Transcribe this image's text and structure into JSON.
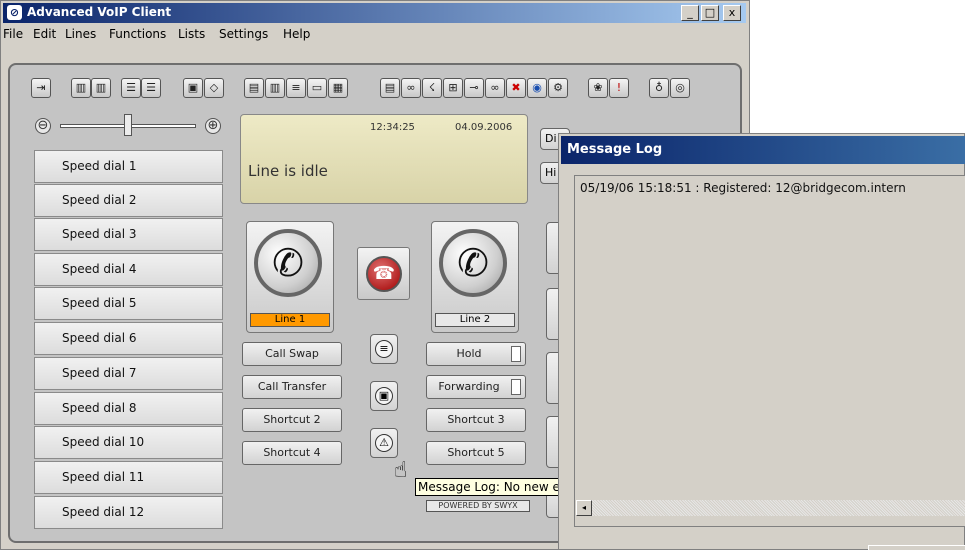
{
  "window": {
    "title": "Advanced VoIP Client",
    "controls": {
      "minimize": "_",
      "maximize": "□",
      "close": "x"
    }
  },
  "menu": [
    "File",
    "Edit",
    "Lines",
    "Functions",
    "Lists",
    "Settings",
    "Help"
  ],
  "toolbar_icons": [
    "line-select-icon",
    "line-dial-icon",
    "line-transfer-icon",
    "phonebook-icon",
    "eraser-icon",
    "contact-icon",
    "list-icon",
    "list-detail-icon",
    "keypad-icon",
    "memory-icon",
    "notes-icon",
    "conference-icon",
    "call-icon",
    "record-icon",
    "voicemail-icon",
    "close-call-icon",
    "forward-icon",
    "link-icon",
    "gift-icon",
    "alert-icon",
    "microphone-icon",
    "speaker-icon"
  ],
  "volume": {
    "minus": "⊖",
    "plus": "⊕",
    "level": 0.47
  },
  "speed_dials": [
    "Speed dial 1",
    "Speed dial 2",
    "Speed dial 3",
    "Speed dial 4",
    "Speed dial 5",
    "Speed dial 6",
    "Speed dial 7",
    "Speed dial 8",
    "Speed dial 10",
    "Speed dial 11",
    "Speed dial 12"
  ],
  "display": {
    "time": "12:34:25",
    "date": "04.09.2006",
    "status": "Line is idle"
  },
  "side_buttons": {
    "b1": "Di",
    "b2": "Hi"
  },
  "lines": {
    "line1": {
      "label": "Line 1",
      "color": "#ff9900"
    },
    "line2": {
      "label": "Line 2"
    }
  },
  "function_buttons": {
    "call_swap": "Call Swap",
    "call_transfer": "Call Transfer",
    "shortcut2": "Shortcut 2",
    "shortcut4": "Shortcut 4",
    "hold": "Hold",
    "forwarding": "Forwarding",
    "shortcut3": "Shortcut 3",
    "shortcut5": "Shortcut 5"
  },
  "tooltip": "Message Log: No new e",
  "powered_by": "POWERED BY SWYX",
  "message_log": {
    "title": "Message Log",
    "entries": [
      "05/19/06 15:18:51 : Registered: 12@bridgecom.intern"
    ]
  }
}
